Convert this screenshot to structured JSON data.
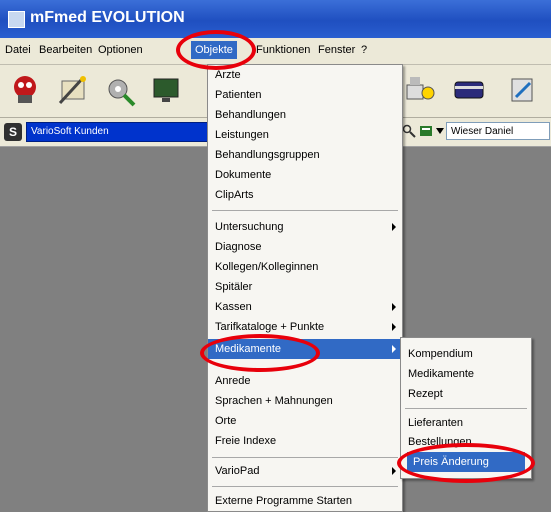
{
  "window": {
    "title": "mFmed EVOLUTION"
  },
  "menubar": [
    {
      "label": "Datei"
    },
    {
      "label": "Bearbeiten"
    },
    {
      "label": "Optionen"
    },
    {
      "label": "Objekte"
    },
    {
      "label": "Funktionen"
    },
    {
      "label": "Fenster"
    },
    {
      "label": "?"
    }
  ],
  "toolbar": {
    "icons": [
      "red-bot-icon",
      "wand-icon",
      "gear-wrench-icon",
      "monitor-icon",
      "scanner-icon",
      "card-icon",
      "tools-icon"
    ],
    "kunden_label": "S",
    "kunden_value": "VarioSoft Kunden",
    "user_value": "Wieser Daniel"
  },
  "objekte_menu": [
    {
      "label": "Ärzte"
    },
    {
      "label": "Patienten"
    },
    {
      "label": "Behandlungen"
    },
    {
      "label": "Leistungen"
    },
    {
      "label": "Behandlungsgruppen"
    },
    {
      "label": "Dokumente"
    },
    {
      "label": "ClipArts"
    },
    {
      "label": "Untersuchung",
      "submenu": true
    },
    {
      "label": "Diagnose"
    },
    {
      "label": "Kollegen/Kolleginnen"
    },
    {
      "label": "Spitäler"
    },
    {
      "label": "Kassen",
      "submenu": true
    },
    {
      "label": "Tarifkataloge + Punkte",
      "submenu": true
    },
    {
      "label": "Medikamente",
      "submenu": true,
      "selected": true
    },
    {
      "label": "Anrede"
    },
    {
      "label": "Sprachen + Mahnungen"
    },
    {
      "label": "Orte"
    },
    {
      "label": "Freie Indexe"
    },
    {
      "label": "VarioPad",
      "submenu": true
    },
    {
      "label": "Externe Programme Starten"
    }
  ],
  "medikamente_submenu": [
    {
      "label": "Kompendium"
    },
    {
      "label": "Medikamente"
    },
    {
      "label": "Rezept"
    },
    {
      "label": "Lieferanten"
    },
    {
      "label": "Bestellungen"
    },
    {
      "label": "Preis Änderung",
      "selected": true
    }
  ],
  "colors": {
    "highlight": "#316ac5",
    "annotation_ring": "#e8000b",
    "titlebar": "#2a5fd0"
  }
}
